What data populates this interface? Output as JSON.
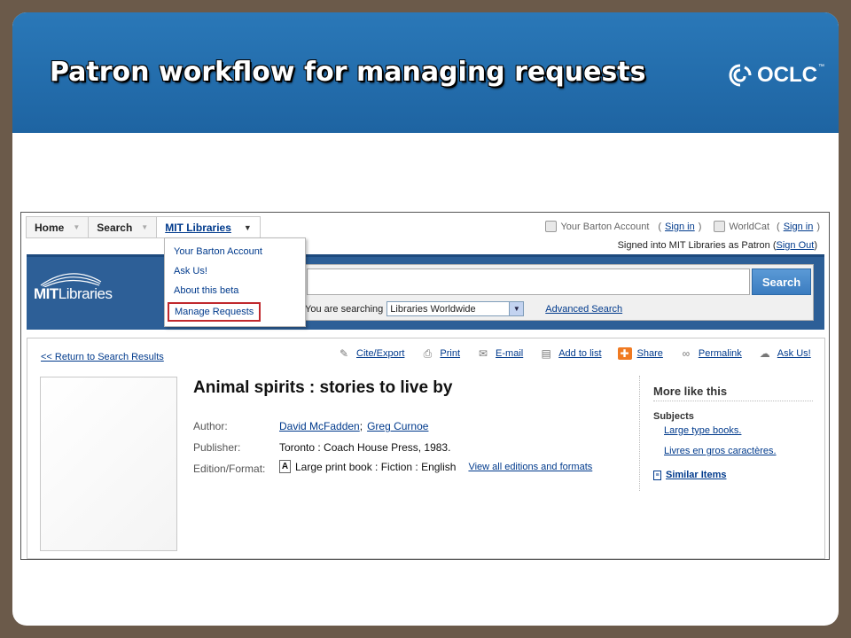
{
  "slide": {
    "title": "Patron workflow for managing requests",
    "logo_text": "OCLC",
    "logo_tm": "™"
  },
  "nav": {
    "tabs": [
      {
        "label": "Home"
      },
      {
        "label": "Search"
      },
      {
        "label": "MIT Libraries"
      }
    ]
  },
  "account": {
    "barton_label": "Your Barton Account",
    "open_paren": "(",
    "close_paren": ")",
    "sign_in": "Sign in",
    "worldcat_label": "WorldCat",
    "worldcat_open": "(",
    "worldcat_close": ")",
    "signed_in_text": "Signed into MIT Libraries as Patron (",
    "sign_out": "Sign Out",
    "signed_close": ")"
  },
  "library": {
    "logo_bold": "MIT",
    "logo_rest": "Libraries"
  },
  "search": {
    "button_label": "Search",
    "searching_label": "You are searching",
    "scope_value": "Libraries Worldwide",
    "advanced_label": "Advanced Search",
    "query": ""
  },
  "menu": {
    "items": [
      {
        "label": "Your Barton Account"
      },
      {
        "label": "Ask Us!"
      },
      {
        "label": "About this beta"
      },
      {
        "label": "Manage Requests"
      }
    ]
  },
  "record": {
    "return_label": "<< Return to Search Results",
    "tools": [
      {
        "icon": "cite-export-icon",
        "glyph": "✎",
        "label": "Cite/Export"
      },
      {
        "icon": "print-icon",
        "glyph": "⎙",
        "label": "Print"
      },
      {
        "icon": "email-icon",
        "glyph": "✉",
        "label": "E-mail"
      },
      {
        "icon": "add-to-list-icon",
        "glyph": "▤",
        "label": "Add to list"
      },
      {
        "icon": "share-icon",
        "glyph": "✚",
        "label": "Share"
      },
      {
        "icon": "permalink-icon",
        "glyph": "∞",
        "label": "Permalink"
      },
      {
        "icon": "ask-us-icon",
        "glyph": "☁",
        "label": "Ask Us!"
      }
    ],
    "title": "Animal spirits : stories to live by",
    "author_label": "Author:",
    "author_1": "David McFadden",
    "author_sep": ";",
    "author_2": "Greg Curnoe",
    "publisher_label": "Publisher:",
    "publisher_value": "Toronto : Coach House Press, 1983.",
    "format_label": "Edition/Format:",
    "format_icon_glyph": "A",
    "format_value": "Large print book : Fiction : English",
    "view_all_label": "View all editions and formats"
  },
  "sidebar": {
    "more_title": "More like this",
    "subjects_label": "Subjects",
    "subjects": [
      "Large type books.",
      "Livres en gros caractères."
    ],
    "similar_label": "Similar Items"
  },
  "colors": {
    "banner": "#1e64a2",
    "link": "#003a8c",
    "highlight": "#c0282d",
    "library_bar": "#2d5f97",
    "search_button": "#3b7cc0"
  }
}
